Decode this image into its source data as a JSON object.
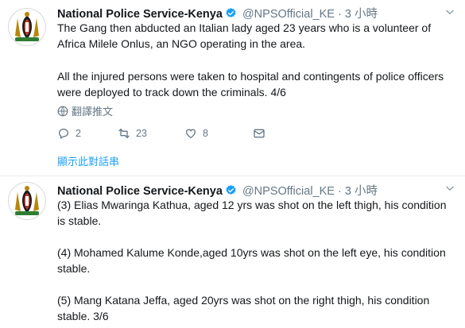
{
  "tweets": [
    {
      "name": "National Police Service-Kenya",
      "handle": "@NPSOfficial_KE",
      "sep": "·",
      "time": "3 小時",
      "paragraphs": [
        "The Gang then abducted  an Italian lady aged 23 years who is a volunteer of Africa Milele Onlus, an NGO operating in the area.",
        "All the injured persons were taken to hospital and contingents of police officers were deployed to track down the criminals.  4/6"
      ],
      "translate_label": "翻譯推文",
      "reply_count": "2",
      "retweet_count": "23",
      "like_count": "8",
      "thread_label": "顯示此對話串"
    },
    {
      "name": "National Police Service-Kenya",
      "handle": "@NPSOfficial_KE",
      "sep": "·",
      "time": "3 小時",
      "paragraphs": [
        "(3) Elias Mwaringa Kathua, aged 12 yrs was shot on the left thigh, his condition is stable.",
        "(4) Mohamed Kalume Konde,aged 10yrs was shot on the left eye, his condition stable.",
        "(5) Mang Katana Jeffa, aged 20yrs was shot on the right thigh, his condition stable.  3/6"
      ]
    }
  ],
  "colors": {
    "link": "#1da1f2",
    "muted": "#657786",
    "text": "#14171a",
    "verified": "#1da1f2"
  },
  "icons": [
    "police-emblem-avatar",
    "verified-badge-icon",
    "chevron-down-icon",
    "globe-icon",
    "reply-icon",
    "retweet-icon",
    "like-icon",
    "direct-message-icon"
  ]
}
